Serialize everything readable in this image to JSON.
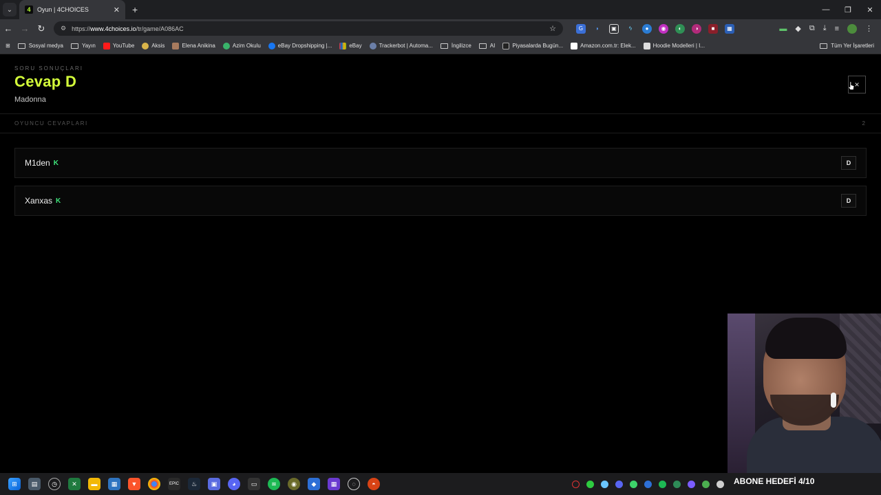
{
  "browser": {
    "tab_title": "Oyun | 4CHOICES",
    "tab_favicon": "4",
    "url_prefix": "https://",
    "url_host": "www.4choices.io",
    "url_path": "/tr/game/A086AC",
    "bookmarks": [
      {
        "label": "Sosyal medya",
        "icon": "folder-icon"
      },
      {
        "label": "Yayın",
        "icon": "folder-icon"
      },
      {
        "label": "YouTube",
        "icon": "youtube-icon"
      },
      {
        "label": "Aksis",
        "icon": "aksis-icon"
      },
      {
        "label": "Elena Anikina",
        "icon": "avatar-icon"
      },
      {
        "label": "Azim Okulu",
        "icon": "azim-icon"
      },
      {
        "label": "eBay Dropshipping |...",
        "icon": "facebook-icon"
      },
      {
        "label": "eBay",
        "icon": "ebay-icon"
      },
      {
        "label": "Trackerbot | Automa...",
        "icon": "trackerbot-icon"
      },
      {
        "label": "İngilizce",
        "icon": "folder-icon"
      },
      {
        "label": "AI",
        "icon": "folder-icon"
      },
      {
        "label": "Piyasalarda Bugün...",
        "icon": "tv-icon"
      },
      {
        "label": "Amazon.com.tr: Elek...",
        "icon": "amazon-icon"
      },
      {
        "label": "Hoodie Modelleri | I...",
        "icon": "hoodie-icon"
      }
    ],
    "all_bookmarks": "Tüm Yer İşaretleri"
  },
  "result": {
    "eyebrow": "SORU SONUÇLARI",
    "title": "Cevap D",
    "answer_text": "Madonna",
    "close_symbol": "×"
  },
  "players_section": {
    "label": "OYUNCU CEVAPLARI",
    "count": "2",
    "players": [
      {
        "name": "M1den",
        "badge": "K",
        "answer": "D"
      },
      {
        "name": "Xanxas",
        "badge": "K",
        "answer": "D"
      }
    ]
  },
  "overlay": {
    "subscriber_goal": "ABONE HEDEFİ 4/10"
  },
  "colors": {
    "accent": "#d4ff3a",
    "badge": "#3ee37a",
    "background": "#000000"
  }
}
